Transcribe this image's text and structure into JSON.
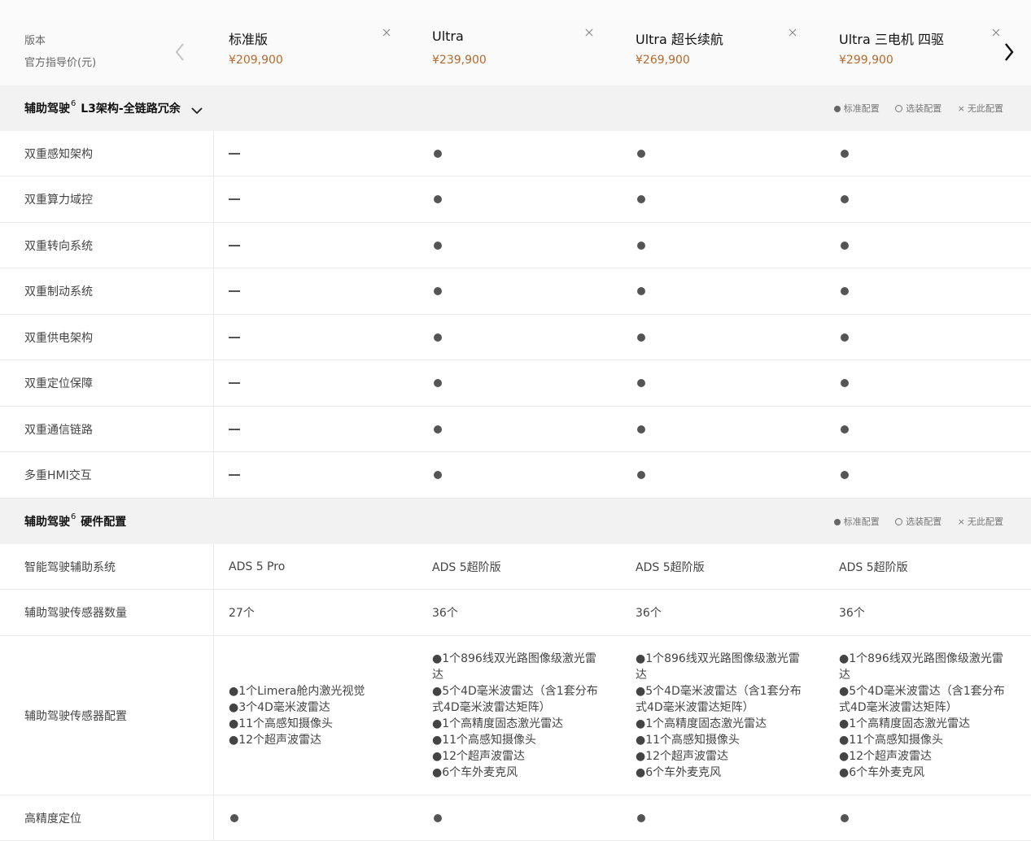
{
  "header": {
    "version_label": "版本",
    "price_label": "官方指导价(元)",
    "models": [
      {
        "name": "标准版",
        "price": "¥209,900"
      },
      {
        "name": "Ultra",
        "price": "¥239,900"
      },
      {
        "name": "Ultra 超长续航",
        "price": "¥269,900"
      },
      {
        "name": "Ultra 三电机 四驱",
        "price": "¥299,900"
      }
    ]
  },
  "legend": {
    "standard": "标准配置",
    "optional": "选装配置",
    "none": "无此配置"
  },
  "sections": [
    {
      "title_pre": "辅助驾驶",
      "sup": "6",
      "title_post": "L3架构-全链路冗余",
      "rows": [
        {
          "label": "双重感知架构",
          "values": [
            "—",
            "●",
            "●",
            "●"
          ]
        },
        {
          "label": "双重算力域控",
          "values": [
            "—",
            "●",
            "●",
            "●"
          ]
        },
        {
          "label": "双重转向系统",
          "values": [
            "—",
            "●",
            "●",
            "●"
          ]
        },
        {
          "label": "双重制动系统",
          "values": [
            "—",
            "●",
            "●",
            "●"
          ]
        },
        {
          "label": "双重供电架构",
          "values": [
            "—",
            "●",
            "●",
            "●"
          ]
        },
        {
          "label": "双重定位保障",
          "values": [
            "—",
            "●",
            "●",
            "●"
          ]
        },
        {
          "label": "双重通信链路",
          "values": [
            "—",
            "●",
            "●",
            "●"
          ]
        },
        {
          "label": "多重HMI交互",
          "values": [
            "—",
            "●",
            "●",
            "●"
          ]
        }
      ]
    },
    {
      "title_pre": "辅助驾驶",
      "sup": "6",
      "title_post": "硬件配置",
      "rows": [
        {
          "label": "智能驾驶辅助系统",
          "values": [
            "ADS 5 Pro",
            "ADS 5超阶版",
            "ADS 5超阶版",
            "ADS 5超阶版"
          ]
        },
        {
          "label": "辅助驾驶传感器数量",
          "values": [
            "27个",
            "36个",
            "36个",
            "36个"
          ]
        },
        {
          "label": "辅助驾驶传感器配置",
          "values": [
            "●1个Limera舱内激光视觉\n●3个4D毫米波雷达\n●11个高感知摄像头\n●12个超声波雷达",
            "●1个896线双光路图像级激光雷达\n●5个4D毫米波雷达（含1套分布式4D毫米波雷达矩阵）\n●1个高精度固态激光雷达\n●11个高感知摄像头\n●12个超声波雷达\n●6个车外麦克风",
            "●1个896线双光路图像级激光雷达\n●5个4D毫米波雷达（含1套分布式4D毫米波雷达矩阵）\n●1个高精度固态激光雷达\n●11个高感知摄像头\n●12个超声波雷达\n●6个车外麦克风",
            "●1个896线双光路图像级激光雷达\n●5个4D毫米波雷达（含1套分布式4D毫米波雷达矩阵）\n●1个高精度固态激光雷达\n●11个高感知摄像头\n●12个超声波雷达\n●6个车外麦克风"
          ]
        },
        {
          "label": "高精度定位",
          "values": [
            "●",
            "●",
            "●",
            "●"
          ]
        }
      ]
    }
  ]
}
